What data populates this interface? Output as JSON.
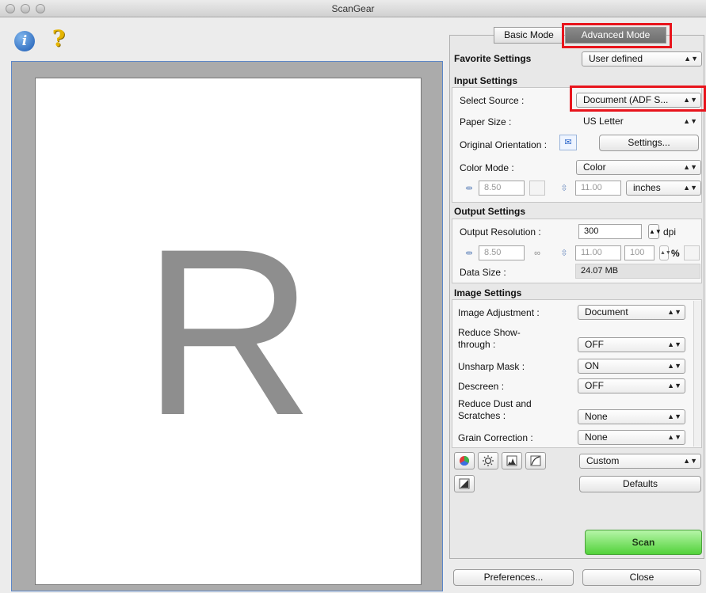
{
  "window": {
    "title": "ScanGear"
  },
  "tabs": {
    "basic": "Basic Mode",
    "advanced": "Advanced Mode"
  },
  "preview": {
    "letter": "R"
  },
  "favorite": {
    "label": "Favorite Settings",
    "value": "User defined"
  },
  "input": {
    "header": "Input Settings",
    "source_label": "Select Source :",
    "source_value": "Document (ADF S...",
    "paper_label": "Paper Size :",
    "paper_value": "US Letter",
    "orientation_label": "Original Orientation :",
    "settings_button": "Settings...",
    "color_label": "Color Mode :",
    "color_value": "Color",
    "width": "8.50",
    "height": "11.00",
    "unit": "inches"
  },
  "output": {
    "header": "Output Settings",
    "resolution_label": "Output Resolution :",
    "resolution_value": "300",
    "dpi": "dpi",
    "width": "8.50",
    "height": "11.00",
    "scale": "100",
    "percent": "%",
    "datasize_label": "Data Size :",
    "datasize_value": "24.07 MB"
  },
  "image": {
    "header": "Image Settings",
    "adjust_label": "Image Adjustment :",
    "adjust_value": "Document",
    "showthrough_label1": "Reduce Show-",
    "showthrough_label2": "through :",
    "showthrough_value": "OFF",
    "unsharp_label": "Unsharp Mask :",
    "unsharp_value": "ON",
    "descreen_label": "Descreen :",
    "descreen_value": "OFF",
    "dust_label1": "Reduce Dust and",
    "dust_label2": "Scratches :",
    "dust_value": "None",
    "grain_label": "Grain Correction :",
    "grain_value": "None"
  },
  "tools": {
    "preset": "Custom",
    "defaults_button": "Defaults"
  },
  "actions": {
    "scan": "Scan",
    "preferences": "Preferences...",
    "close": "Close"
  },
  "colors": {
    "highlight": "#e8141c",
    "scan_green": "#52d23a"
  }
}
